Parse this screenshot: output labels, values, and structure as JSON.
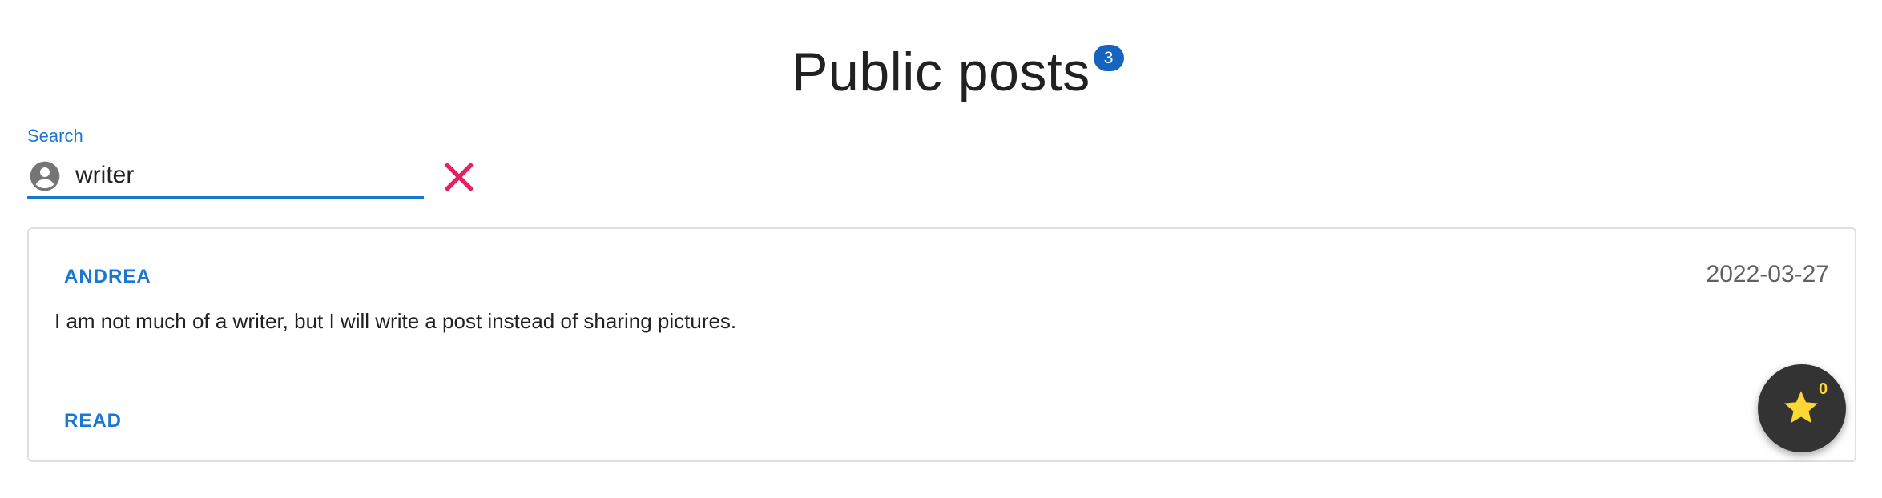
{
  "header": {
    "title": "Public posts",
    "post_count": "3"
  },
  "search": {
    "label": "Search",
    "value": "writer",
    "icon": "account-circle-icon",
    "clear_icon": "close-icon"
  },
  "posts": [
    {
      "author": "ANDREA",
      "date": "2022-03-27",
      "text": "I am not much of a writer, but I will write a post instead of sharing pictures.",
      "action_label": "READ"
    }
  ],
  "favorites": {
    "icon": "star-icon",
    "count": "0"
  },
  "colors": {
    "accent": "#1976d2",
    "badge": "#1565c0",
    "clear": "#e91e63",
    "fab_background": "#333333",
    "star": "#fdd835"
  }
}
